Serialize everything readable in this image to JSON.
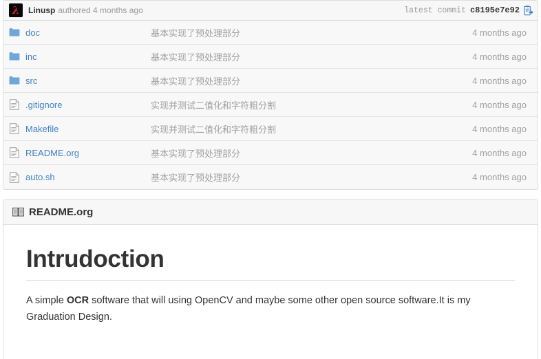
{
  "commit_bar": {
    "avatar_glyph": "λ",
    "avatar_icon": "lambda-avatar-icon",
    "author": "Linusp",
    "authored_text": "authored 4 months ago",
    "latest_commit_label": "latest commit",
    "commit_sha": "c8195e7e92",
    "copy_icon": "copy-to-clipboard-icon",
    "accent_link_color": "#4183c4"
  },
  "file_list": {
    "columns": [
      "icon",
      "name",
      "message",
      "age"
    ],
    "rows": [
      {
        "type": "folder",
        "icon": "folder-icon",
        "name": "doc",
        "message": "基本实现了预处理部分",
        "age": "4 months ago"
      },
      {
        "type": "folder",
        "icon": "folder-icon",
        "name": "inc",
        "message": "基本实现了预处理部分",
        "age": "4 months ago"
      },
      {
        "type": "folder",
        "icon": "folder-icon",
        "name": "src",
        "message": "基本实现了预处理部分",
        "age": "4 months ago"
      },
      {
        "type": "file",
        "icon": "file-icon",
        "name": ".gitignore",
        "message": "实现并测试二值化和字符粗分割",
        "age": "4 months ago"
      },
      {
        "type": "file",
        "icon": "file-icon",
        "name": "Makefile",
        "message": "实现并测试二值化和字符粗分割",
        "age": "4 months ago"
      },
      {
        "type": "file",
        "icon": "file-icon",
        "name": "README.org",
        "message": "基本实现了预处理部分",
        "age": "4 months ago"
      },
      {
        "type": "file",
        "icon": "file-icon",
        "name": "auto.sh",
        "message": "基本实现了预处理部分",
        "age": "4 months ago"
      }
    ]
  },
  "readme": {
    "book_icon": "open-book-icon",
    "filename": "README.org",
    "heading": "Intrudoction",
    "paragraph_parts": {
      "before": "A simple ",
      "bold": "OCR",
      "after": " software that will using OpenCV and maybe some other open source software.It is my Graduation Design."
    }
  }
}
